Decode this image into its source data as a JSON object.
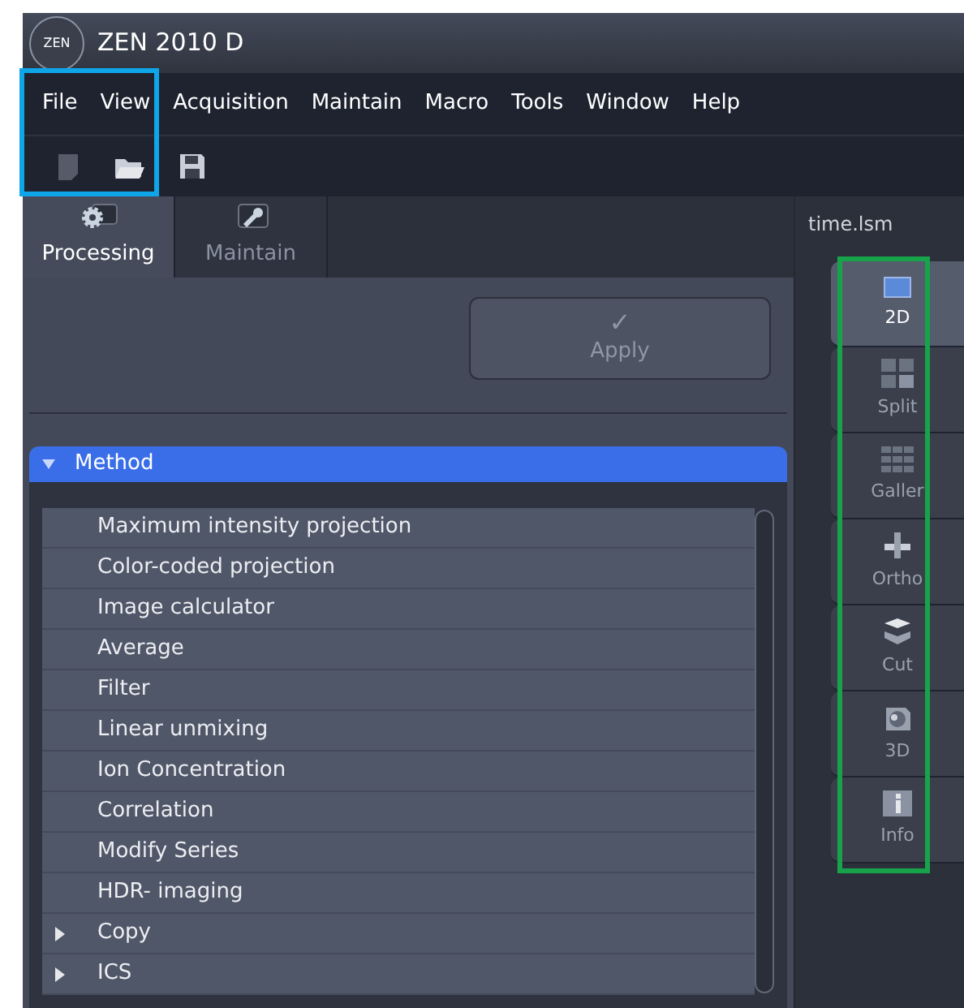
{
  "window": {
    "logo": "ZEN",
    "title": "ZEN 2010 D"
  },
  "menu": [
    "File",
    "View",
    "Acquisition",
    "Maintain",
    "Macro",
    "Tools",
    "Window",
    "Help"
  ],
  "toolbar": [
    {
      "kind": "new",
      "disabled": true
    },
    {
      "kind": "open",
      "disabled": false
    },
    {
      "kind": "save",
      "disabled": false
    }
  ],
  "tabs": [
    {
      "label": "Processing",
      "kind": "gear",
      "selected": true
    },
    {
      "label": "Maintain",
      "kind": "wrench",
      "selected": false
    }
  ],
  "apply_button": {
    "label": "Apply",
    "icon": "✓",
    "disabled": true
  },
  "method": {
    "title": "Method",
    "expanded": true,
    "items": [
      {
        "label": "Maximum intensity projection",
        "has_children": false
      },
      {
        "label": "Color-coded projection",
        "has_children": false
      },
      {
        "label": "Image calculator",
        "has_children": false
      },
      {
        "label": "Average",
        "has_children": false
      },
      {
        "label": "Filter",
        "has_children": false
      },
      {
        "label": "Linear unmixing",
        "has_children": false
      },
      {
        "label": "Ion Concentration",
        "has_children": false
      },
      {
        "label": "Correlation",
        "has_children": false
      },
      {
        "label": "Modify Series",
        "has_children": false
      },
      {
        "label": "HDR- imaging",
        "has_children": false
      },
      {
        "label": "Copy",
        "has_children": true
      },
      {
        "label": "ICS",
        "has_children": true
      }
    ]
  },
  "document_tab": {
    "label": "time.lsm"
  },
  "view_buttons": [
    {
      "label": "2D",
      "kind": "flat",
      "selected": true
    },
    {
      "label": "Split",
      "kind": "split",
      "selected": false
    },
    {
      "label": "Galler",
      "kind": "gallery",
      "selected": false
    },
    {
      "label": "Ortho",
      "kind": "ortho",
      "selected": false
    },
    {
      "label": "Cut",
      "kind": "cut",
      "selected": false
    },
    {
      "label": "3D",
      "kind": "volume",
      "selected": false
    },
    {
      "label": "Info",
      "kind": "info",
      "selected": false
    }
  ],
  "highlights": [
    {
      "kind": "menu",
      "color": "#0ea5e9"
    },
    {
      "kind": "views",
      "color": "#16a34a"
    }
  ]
}
